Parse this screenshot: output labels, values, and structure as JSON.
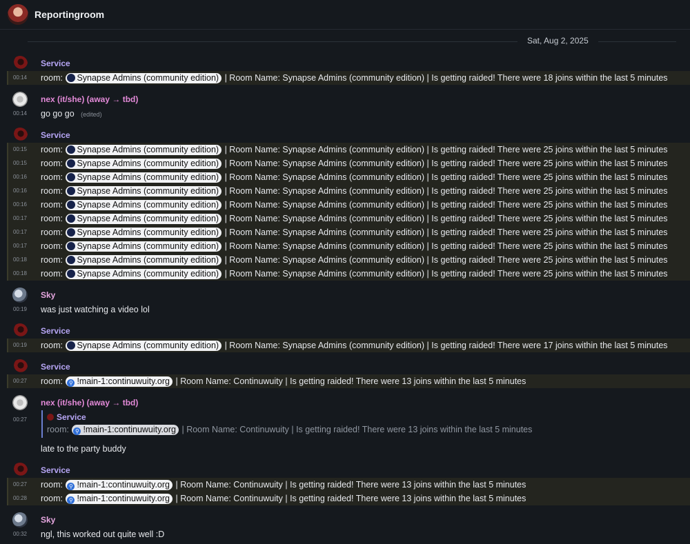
{
  "header": {
    "title": "Reportingroom"
  },
  "date_separator": "Sat, Aug 2, 2025",
  "pill_labels": {
    "synapse": "Synapse Admins (community edition)",
    "main": "!main-1:continuwuity.org"
  },
  "text": {
    "room_prefix": "room:",
    "synapse_tail_18": "| Room Name: Synapse Admins (community edition) | Is getting raided! There were 18 joins within the last 5 minutes",
    "synapse_tail_25": "| Room Name: Synapse Admins (community edition) | Is getting raided! There were 25 joins within the last 5 minutes",
    "synapse_tail_17": "| Room Name: Synapse Admins (community edition) | Is getting raided! There were 17 joins within the last 5 minutes",
    "continuwuity_tail_13": "| Room Name: Continuwuity | Is getting raided! There were 13 joins within the last 5 minutes",
    "edited": "(edited)"
  },
  "senders": {
    "service": "Service",
    "nex": "nex (it/she) (away → tbd)",
    "sky": "Sky"
  },
  "groups": [
    {
      "times": [
        "00:14"
      ]
    },
    {
      "times": [
        "00:14"
      ],
      "body": "go go go"
    },
    {
      "times": [
        "00:15",
        "00:15",
        "00:16",
        "00:16",
        "00:16",
        "00:17",
        "00:17",
        "00:17",
        "00:18",
        "00:18"
      ]
    },
    {
      "times": [
        "00:19"
      ],
      "body": "was just watching a video lol"
    },
    {
      "times": [
        "00:19"
      ]
    },
    {
      "times": [
        "00:27"
      ]
    },
    {
      "times": [
        "00:27"
      ],
      "body": "late to the party buddy"
    },
    {
      "times": [
        "00:27",
        "00:28"
      ]
    },
    {
      "times": [
        "00:32"
      ],
      "body": "ngl, this worked out quite well :D"
    }
  ]
}
